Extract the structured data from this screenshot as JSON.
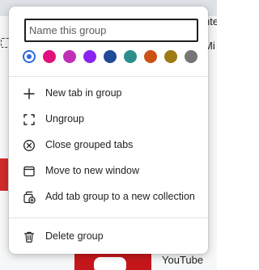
{
  "background": {
    "text_top_right": "nte",
    "text_right_2": "Mi",
    "youtube_label": "YouTube"
  },
  "popup": {
    "name_input": {
      "value": "",
      "placeholder": "Name this group"
    },
    "colors": [
      {
        "name": "blue",
        "hex": "#2d68df",
        "selected": true
      },
      {
        "name": "pink",
        "hex": "#e0117a",
        "selected": false
      },
      {
        "name": "purple",
        "hex": "#c030b6",
        "selected": false
      },
      {
        "name": "violet",
        "hex": "#8a23ef",
        "selected": false
      },
      {
        "name": "navy",
        "hex": "#1d4b96",
        "selected": false
      },
      {
        "name": "teal",
        "hex": "#2b8e8d",
        "selected": false
      },
      {
        "name": "orange",
        "hex": "#cc5115",
        "selected": false
      },
      {
        "name": "olive",
        "hex": "#9e7a12",
        "selected": false
      },
      {
        "name": "grey",
        "hex": "#757575",
        "selected": false
      }
    ],
    "menu": {
      "new_tab": "New tab in group",
      "ungroup": "Ungroup",
      "close_grouped": "Close grouped tabs",
      "move_window": "Move to new window",
      "add_collection": "Add tab group to a new collection",
      "delete_group": "Delete group"
    }
  }
}
